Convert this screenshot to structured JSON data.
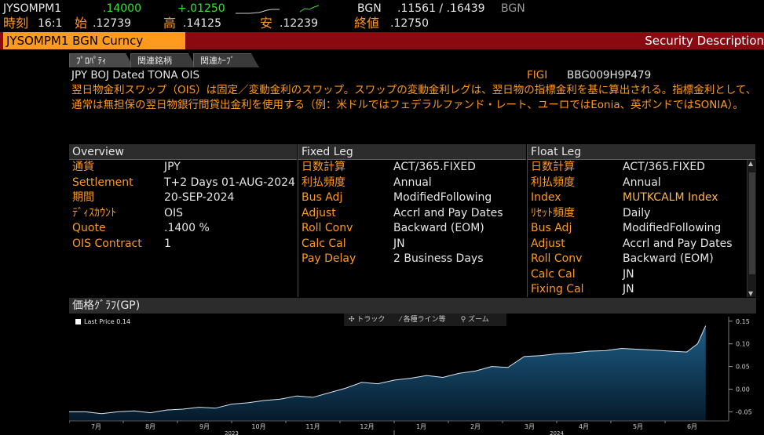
{
  "quote": {
    "ticker": "JYSOMPM1",
    "last": ".14000",
    "change": "+.01250",
    "bgn1": "BGN",
    "bid_ask": ".11561 / .16439",
    "bgn2": "BGN",
    "time_label": "時刻",
    "time": "16:1",
    "open_label": "始",
    "open": ".12739",
    "high_label": "高",
    "high": ".14125",
    "low_label": "安",
    "low": ".12239",
    "close_label": "終値",
    "close": ".12750"
  },
  "title_bar": {
    "security": "JYSOMPM1 BGN Curncy",
    "function": "Security Description"
  },
  "tabs": [
    {
      "label": "ﾌﾟﾛﾊﾟﾃｨ",
      "active": true
    },
    {
      "label": "関連銘柄",
      "active": false
    },
    {
      "label": "関連ｶｰﾌﾞ",
      "active": false
    }
  ],
  "info": {
    "name": "JPY BOJ Dated TONA OIS",
    "figi_label": "FIGI",
    "figi": "BBG009H9P479",
    "description": "翌日物金利スワップ（OIS）は固定／変動金利のスワップ。スワップの変動金利レグは、翌日物の指標金利を基に算出される。指標金利として、通常は無担保の翌日物銀行間貸出金利を使用する（例：米ドルではフェデラルファンド・レート、ユーロではEonia、英ポンドではSONIA）。"
  },
  "overview": {
    "header": "Overview",
    "rows": [
      {
        "k": "通貨",
        "v": "JPY"
      },
      {
        "k": "Settlement",
        "v": "T+2 Days  01-AUG-2024"
      },
      {
        "k": "期間",
        "v": "20-SEP-2024"
      },
      {
        "k": "ﾃﾞｨｽｶｳﾝﾄ",
        "v": "OIS"
      },
      {
        "k": "Quote",
        "v": ".1400  %"
      },
      {
        "k": "OIS Contract",
        "v": "1"
      }
    ]
  },
  "fixed_leg": {
    "header": "Fixed Leg",
    "rows": [
      {
        "k": "日数計算",
        "v": "ACT/365.FIXED"
      },
      {
        "k": "利払頻度",
        "v": "Annual"
      },
      {
        "k": "Bus Adj",
        "v": "ModifiedFollowing"
      },
      {
        "k": "Adjust",
        "v": "Accrl and Pay Dates"
      },
      {
        "k": "Roll Conv",
        "v": "Backward (EOM)"
      },
      {
        "k": "Calc Cal",
        "v": "JN"
      },
      {
        "k": "Pay Delay",
        "v": "2 Business Days"
      }
    ]
  },
  "float_leg": {
    "header": "Float Leg",
    "rows": [
      {
        "k": "日数計算",
        "v": "ACT/365.FIXED"
      },
      {
        "k": "利払頻度",
        "v": "Annual"
      },
      {
        "k": "Index",
        "v": "MUTKCALM Index"
      },
      {
        "k": "ﾘｾｯﾄ頻度",
        "v": "Daily"
      },
      {
        "k": "Bus Adj",
        "v": "ModifiedFollowing"
      },
      {
        "k": "Adjust",
        "v": "Accrl and Pay Dates"
      },
      {
        "k": "Roll Conv",
        "v": "Backward (EOM)"
      },
      {
        "k": "Calc Cal",
        "v": "JN"
      },
      {
        "k": "Fixing Cal",
        "v": "JN"
      }
    ]
  },
  "chart": {
    "header": "価格ｸﾞﾗﾌ(GP)",
    "legend": "Last Price  0.14",
    "tools": [
      "トラック",
      "各種ライン等",
      "ズーム"
    ]
  },
  "colors": {
    "accent": "#ff9a1e",
    "title_bar": "#8b0a12",
    "up": "#2ee62e",
    "chart_fill_top": "#1d5e86"
  },
  "chart_data": {
    "type": "area",
    "title": "",
    "xlabel": "",
    "ylabel": "",
    "ylim": [
      -0.07,
      0.16
    ],
    "y_ticks": [
      "0.15",
      "0.10",
      "0.05",
      "0.00",
      "-0.05"
    ],
    "y_tick_values": [
      0.15,
      0.1,
      0.05,
      0.0,
      -0.05
    ],
    "x_ticks": [
      "7月",
      "8月",
      "9月",
      "10月",
      "11月",
      "12月",
      "1月",
      "2月",
      "3月",
      "4月",
      "5月",
      "6月"
    ],
    "x_years": [
      "2023",
      "2024"
    ],
    "series": [
      {
        "name": "Last Price",
        "x": [
          0,
          0.3,
          0.6,
          0.9,
          1.2,
          1.5,
          1.8,
          2.1,
          2.4,
          2.7,
          3.0,
          3.3,
          3.6,
          3.9,
          4.2,
          4.5,
          4.8,
          5.1,
          5.4,
          5.7,
          6.0,
          6.3,
          6.6,
          6.9,
          7.2,
          7.5,
          7.8,
          8.1,
          8.4,
          8.7,
          9.0,
          9.3,
          9.6,
          9.9,
          10.2,
          10.5,
          10.8,
          11.1,
          11.4,
          11.6,
          11.75
        ],
        "values": [
          -0.05,
          -0.05,
          -0.054,
          -0.05,
          -0.048,
          -0.052,
          -0.046,
          -0.044,
          -0.04,
          -0.042,
          -0.033,
          -0.03,
          -0.025,
          -0.022,
          -0.015,
          -0.018,
          -0.008,
          0.002,
          0.015,
          0.012,
          0.02,
          0.024,
          0.03,
          0.026,
          0.035,
          0.04,
          0.05,
          0.048,
          0.072,
          0.074,
          0.078,
          0.08,
          0.084,
          0.085,
          0.09,
          0.088,
          0.086,
          0.084,
          0.082,
          0.1,
          0.14
        ]
      }
    ],
    "legend": "top-left",
    "grid": false
  }
}
